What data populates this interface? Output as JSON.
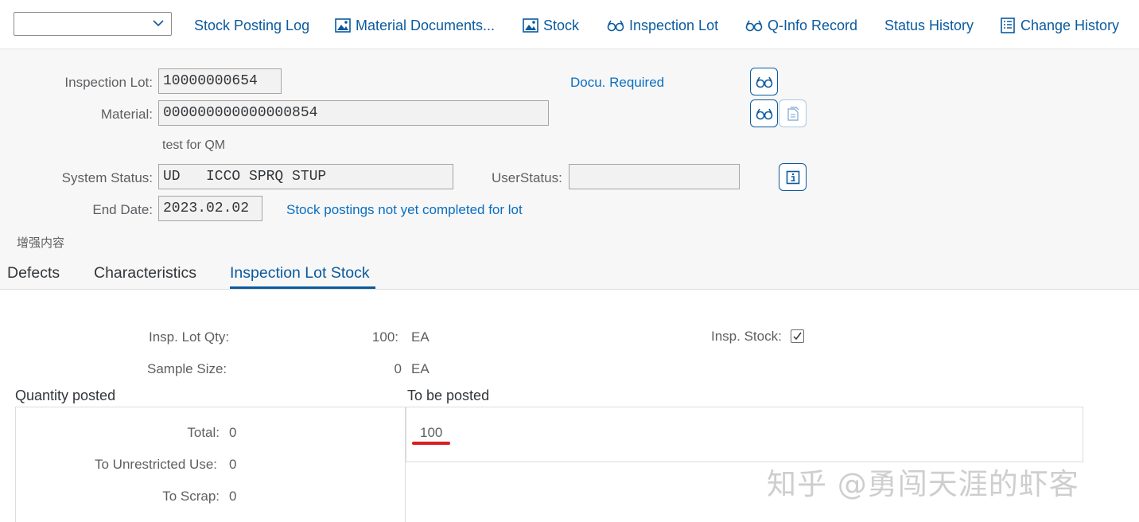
{
  "toolbar": {
    "dropdown_value": "",
    "buttons": [
      {
        "label": "Stock Posting Log",
        "icon": null
      },
      {
        "label": "Material Documents...",
        "icon": "image-icon"
      },
      {
        "label": "Stock",
        "icon": "image-icon"
      },
      {
        "label": "Inspection Lot",
        "icon": "glasses-icon"
      },
      {
        "label": "Q-Info Record",
        "icon": "glasses-icon"
      },
      {
        "label": "Status History",
        "icon": null
      },
      {
        "label": "Change History",
        "icon": "document-list-icon"
      }
    ]
  },
  "header": {
    "inspection_lot_label": "Inspection Lot:",
    "inspection_lot_value": "10000000654",
    "docu_required": "Docu. Required",
    "material_label": "Material:",
    "material_value": "000000000000000854",
    "material_desc": "test for QM",
    "system_status_label": "System Status:",
    "system_status_value": "UD   ICCO SPRQ STUP",
    "user_status_label": "UserStatus:",
    "user_status_value": "",
    "end_date_label": "End Date:",
    "end_date_value": "2023.02.02",
    "stock_note": "Stock postings not yet completed for lot",
    "enhancement_label": "增强内容"
  },
  "tabs": [
    {
      "label": "Defects",
      "active": false
    },
    {
      "label": "Characteristics",
      "active": false
    },
    {
      "label": "Inspection Lot Stock",
      "active": true
    }
  ],
  "stock": {
    "lot_qty_label": "Insp. Lot Qty:",
    "lot_qty_value": "100:",
    "lot_qty_unit": "EA",
    "sample_size_label": "Sample Size:",
    "sample_size_value": "0",
    "sample_size_unit": "EA",
    "insp_stock_label": "Insp. Stock:",
    "insp_stock_checked": true,
    "quantity_posted_title": "Quantity posted",
    "to_be_posted_title": "To be posted",
    "total_label": "Total:",
    "total_value": "0",
    "unrestricted_label": "To Unrestricted Use:",
    "unrestricted_value": "0",
    "scrap_label": "To Scrap:",
    "scrap_value": "0",
    "to_be_posted_value": "100"
  },
  "watermark": "知乎 @勇闯天涯的虾客",
  "colors": {
    "link": "#0a6ec2",
    "accent": "#0a5a9e",
    "annotation": "#d81e1e"
  }
}
